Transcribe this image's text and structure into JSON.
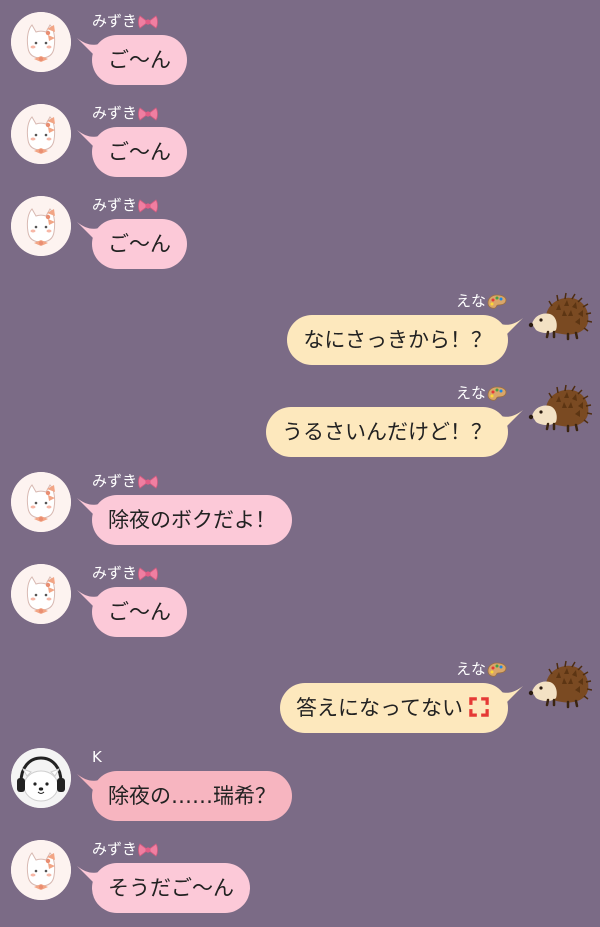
{
  "colors": {
    "background": "#7b6b86",
    "bubble_mizuki": "#fcc9d8",
    "bubble_ena": "#fde8bd",
    "bubble_k": "#f7b5c0"
  },
  "messages": [
    {
      "sender": "mizuki",
      "name": "みずき",
      "name_icon": "ribbon-icon",
      "text": "ご〜ん"
    },
    {
      "sender": "mizuki",
      "name": "みずき",
      "name_icon": "ribbon-icon",
      "text": "ご〜ん"
    },
    {
      "sender": "mizuki",
      "name": "みずき",
      "name_icon": "ribbon-icon",
      "text": "ご〜ん"
    },
    {
      "sender": "ena",
      "name": "えな",
      "name_icon": "palette-icon",
      "text": "なにさっきから！？"
    },
    {
      "sender": "ena",
      "name": "えな",
      "name_icon": "palette-icon",
      "text": "うるさいんだけど！？"
    },
    {
      "sender": "mizuki",
      "name": "みずき",
      "name_icon": "ribbon-icon",
      "text": "除夜のボクだよ！"
    },
    {
      "sender": "mizuki",
      "name": "みずき",
      "name_icon": "ribbon-icon",
      "text": "ご〜ん"
    },
    {
      "sender": "ena",
      "name": "えな",
      "name_icon": "palette-icon",
      "text": "答えになってない",
      "trailing_icon": "anger-icon"
    },
    {
      "sender": "k",
      "name": "K",
      "text": "除夜の……瑞希？"
    },
    {
      "sender": "mizuki",
      "name": "みずき",
      "name_icon": "ribbon-icon",
      "text": "そうだご〜ん"
    }
  ]
}
